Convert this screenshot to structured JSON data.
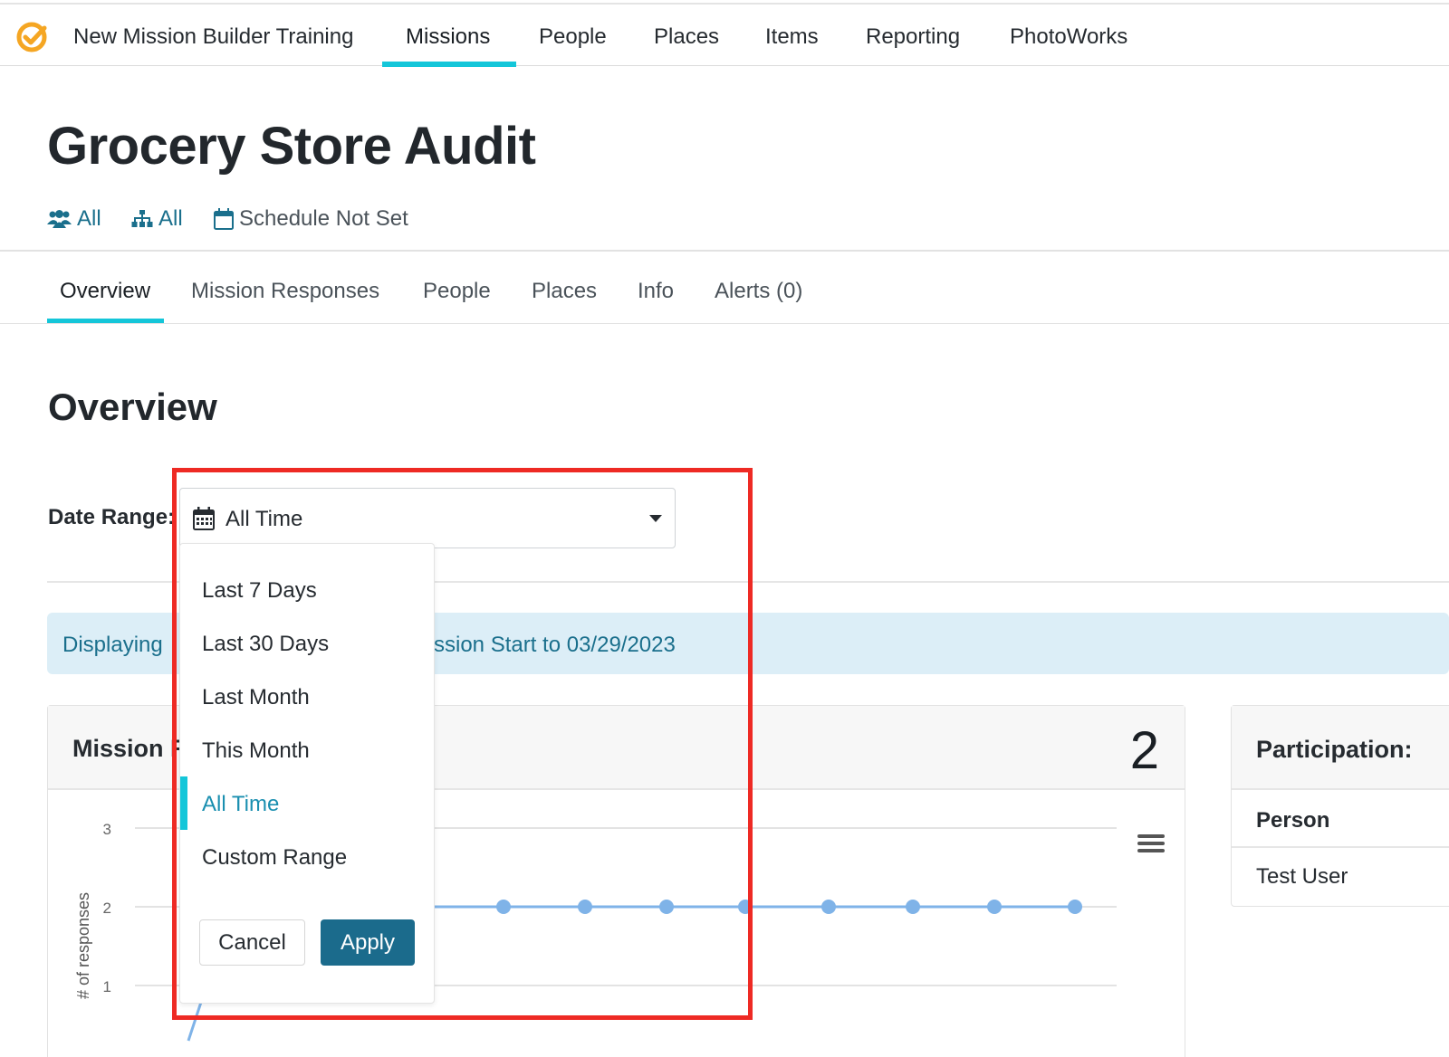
{
  "topnav": {
    "brand": "New Mission Builder Training",
    "links": [
      "Missions",
      "People",
      "Places",
      "Items",
      "Reporting",
      "PhotoWorks"
    ],
    "active": "Missions"
  },
  "page": {
    "title": "Grocery Store Audit",
    "meta": {
      "people_filter": "All",
      "places_filter": "All",
      "schedule": "Schedule Not Set"
    }
  },
  "subtabs": {
    "items": [
      "Overview",
      "Mission Responses",
      "People",
      "Places",
      "Info",
      "Alerts (0)"
    ],
    "active": "Overview"
  },
  "overview": {
    "title": "Overview",
    "date_range_label": "Date Range:",
    "date_range_value": "All Time",
    "info_text_start": "Displaying ",
    "info_text_end": "ssion Start to 03/29/2023"
  },
  "dropdown": {
    "options": [
      "Last 7 Days",
      "Last 30 Days",
      "Last Month",
      "This Month",
      "All Time",
      "Custom Range"
    ],
    "selected": "All Time",
    "cancel_label": "Cancel",
    "apply_label": "Apply"
  },
  "responses_card": {
    "title_visible": "Mission R",
    "count": "2"
  },
  "chart_data": {
    "type": "line",
    "ylabel": "# of responses",
    "yticks": [
      "1",
      "2",
      "3"
    ],
    "ylim": [
      0,
      3
    ],
    "series": [
      {
        "values": [
          2,
          2,
          2,
          2,
          2,
          2,
          2,
          2
        ]
      }
    ]
  },
  "participation": {
    "title": "Participation:",
    "header": "Person",
    "rows": [
      "Test User"
    ]
  },
  "colors": {
    "accent": "#14c6d9",
    "link": "#1a6f8c",
    "primary_button": "#1b6b8c",
    "highlight": "#ee2a24",
    "series": "#7fb3e8"
  }
}
